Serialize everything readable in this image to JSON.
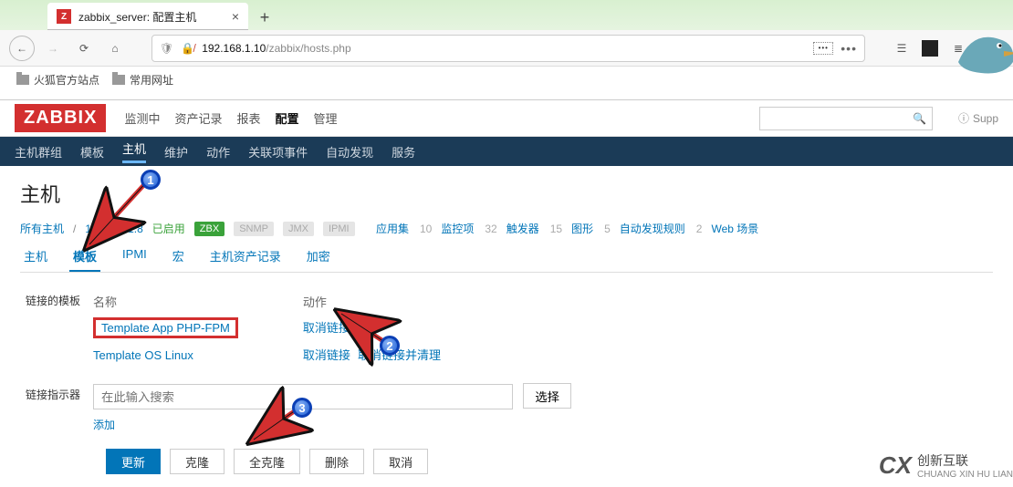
{
  "browser": {
    "tab_title": "zabbix_server: 配置主机",
    "url_host": "192.168.1.10",
    "url_path": "/zabbix/hosts.php",
    "url_prefix_box": "…",
    "bookmarks": [
      "火狐官方站点",
      "常用网址"
    ]
  },
  "zabbix": {
    "logo": "ZABBIX",
    "menu1": [
      "监测中",
      "资产记录",
      "报表",
      "配置",
      "管理"
    ],
    "menu1_active_index": 3,
    "support": "Supp",
    "subnav": [
      "主机群组",
      "模板",
      "主机",
      "维护",
      "动作",
      "关联项事件",
      "自动发现",
      "服务"
    ],
    "subnav_active_index": 2,
    "page_title": "主机",
    "crumbs": {
      "all_hosts": "所有主机",
      "host_ip": "192.168.1.8",
      "enabled": "已启用",
      "chips": [
        "ZBX",
        "SNMP",
        "JMX",
        "IPMI"
      ],
      "counts": [
        {
          "label": "应用集",
          "n": "10"
        },
        {
          "label": "监控项",
          "n": "32"
        },
        {
          "label": "触发器",
          "n": "15"
        },
        {
          "label": "图形",
          "n": "5"
        },
        {
          "label": "自动发现规则",
          "n": "2"
        },
        {
          "label": "Web 场景",
          "n": ""
        }
      ]
    },
    "tabs": [
      "主机",
      "模板",
      "IPMI",
      "宏",
      "主机资产记录",
      "加密"
    ],
    "tab_active_index": 1,
    "linked_templates": {
      "label": "链接的模板",
      "col_name": "名称",
      "col_action": "动作",
      "rows": [
        {
          "name": "Template App PHP-FPM",
          "actions": [
            "取消链接"
          ]
        },
        {
          "name": "Template OS Linux",
          "actions": [
            "取消链接",
            "取消链接并清理"
          ]
        }
      ]
    },
    "link_indicator": {
      "label": "链接指示器",
      "placeholder": "在此输入搜索",
      "select_btn": "选择",
      "add_link": "添加"
    },
    "buttons": {
      "update": "更新",
      "clone": "克隆",
      "full_clone": "全克隆",
      "delete": "删除",
      "cancel": "取消"
    }
  },
  "annotations": {
    "b1": "1",
    "b2": "2",
    "b3": "3"
  },
  "watermark": {
    "brand": "创新互联",
    "sub": "CHUANG XIN HU LIAN"
  }
}
